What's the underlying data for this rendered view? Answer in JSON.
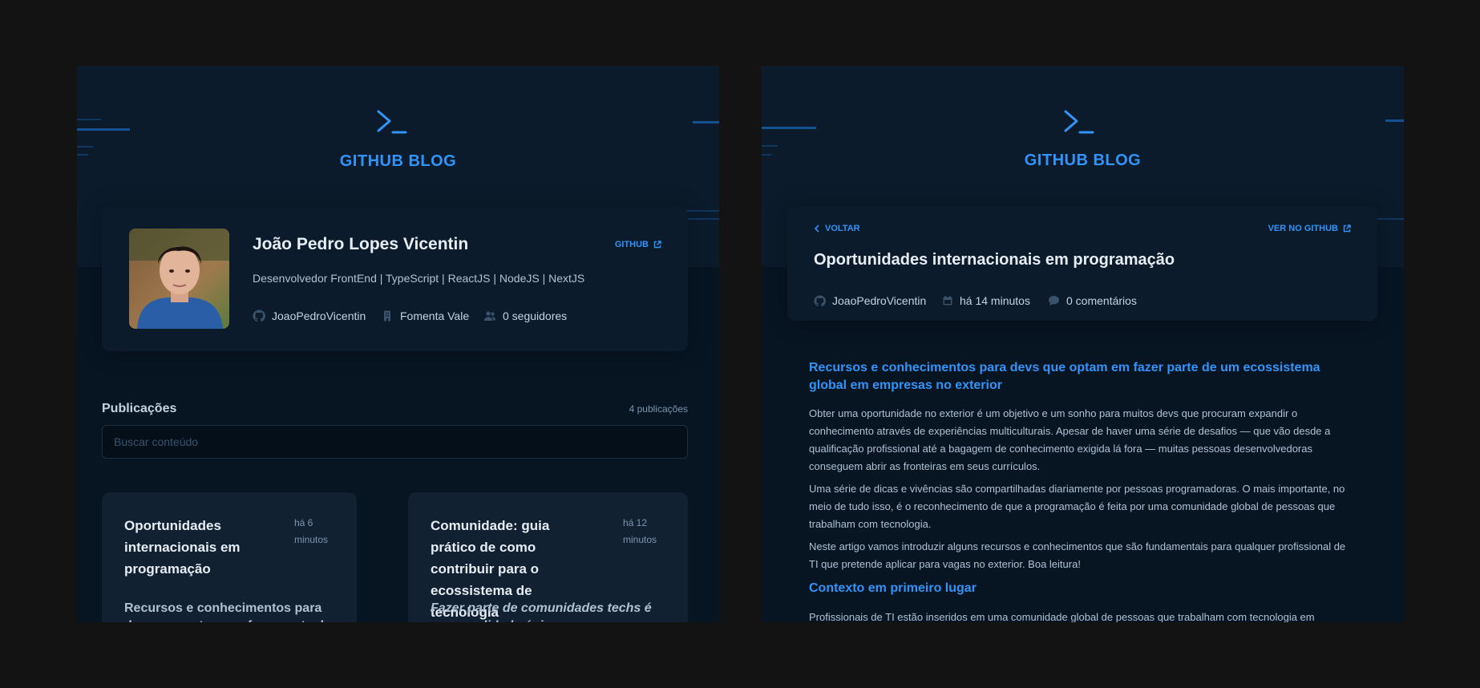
{
  "colors": {
    "page_bg": "#131313",
    "screen_bg": "#071422",
    "header_bg": "#0b1b2b",
    "card_bg": "#0b1b2b",
    "post_card_bg": "#112131",
    "accent": "#3294f8",
    "title_text": "#e7edf4",
    "body_text": "#afc2d4"
  },
  "brand": {
    "logo_icon": "terminal-prompt-icon",
    "name": "GITHUB BLOG"
  },
  "profile": {
    "avatar_icon": "user-avatar-photo",
    "name": "João Pedro Lopes Vicentin",
    "bio": "Desenvolvedor FrontEnd | TypeScript | ReactJS | NodeJS | NextJS",
    "github_label": "GITHUB",
    "github_icon": "external-link-icon",
    "stats": [
      {
        "icon": "github-icon",
        "label": "JoaoPedroVicentin"
      },
      {
        "icon": "building-icon",
        "label": "Fomenta Vale"
      },
      {
        "icon": "users-icon",
        "label": "0 seguidores"
      }
    ]
  },
  "publications": {
    "title": "Publicações",
    "count": "4 publicações",
    "search_placeholder": "Buscar conteúdo",
    "search_value": "",
    "posts": [
      {
        "title": "Oportunidades internacionais em programação",
        "time": "há 6 minutos",
        "excerpt": "Recursos e conhecimentos para devs que optam em fazer parte de um"
      },
      {
        "title": "Comunidade: guia prático de como contribuir para o ecossistema de tecnologia",
        "time": "há 12 minutos",
        "excerpt": "Fazer parte de comunidades techs é uma qualidade única para quem busca"
      }
    ]
  },
  "post": {
    "back_label": "VOLTAR",
    "back_icon": "chevron-left-icon",
    "view_label": "VER NO GITHUB",
    "view_icon": "external-link-icon",
    "title": "Oportunidades internacionais em programação",
    "meta": [
      {
        "icon": "github-icon",
        "label": "JoaoPedroVicentin"
      },
      {
        "icon": "calendar-icon",
        "label": "há 14 minutos"
      },
      {
        "icon": "comment-icon",
        "label": "0 comentários"
      }
    ],
    "heading": "Recursos e conhecimentos para devs que optam em fazer parte de um ecossistema global em empresas no exterior",
    "paragraphs": [
      "Obter uma oportunidade no exterior é um objetivo e um sonho para muitos devs que procuram expandir o conhecimento através de experiências multiculturais. Apesar de haver uma série de desafios — que vão desde a qualificação profissional até a bagagem de conhecimento exigida lá fora — muitas pessoas desenvolvedoras conseguem abrir as fronteiras em seus currículos.",
      "Uma série de dicas e vivências são compartilhadas diariamente por pessoas programadoras. O mais importante, no meio de tudo isso, é o reconhecimento de que a programação é feita por uma comunidade global de pessoas que trabalham com tecnologia.",
      "Neste artigo vamos introduzir alguns recursos e conhecimentos que são fundamentais para qualquer profissional de TI que pretende aplicar para vagas no exterior. Boa leitura!"
    ],
    "subheading": "Contexto em primeiro lugar",
    "last_paragraph": "Profissionais de TI estão inseridos em uma comunidade global de pessoas que trabalham com tecnologia em"
  }
}
